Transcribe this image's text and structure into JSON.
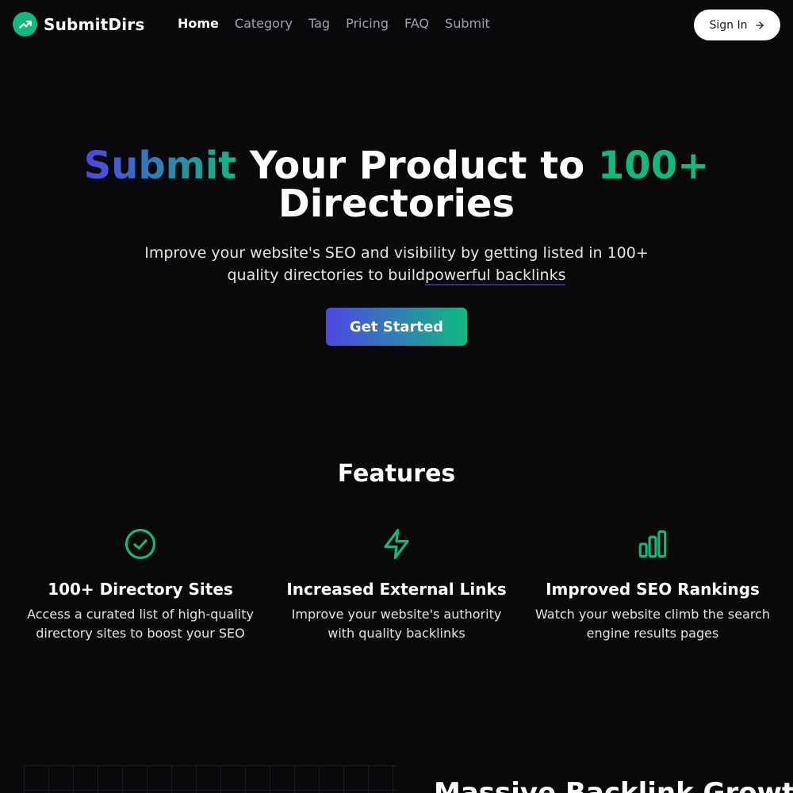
{
  "brand": {
    "name": "SubmitDirs",
    "logo_icon": "trending-up-icon",
    "accent": "#10b981",
    "accent_alt": "#4f46e5"
  },
  "nav": {
    "items": [
      {
        "label": "Home",
        "active": true
      },
      {
        "label": "Category"
      },
      {
        "label": "Tag"
      },
      {
        "label": "Pricing"
      },
      {
        "label": "FAQ"
      },
      {
        "label": "Submit"
      }
    ]
  },
  "header": {
    "signin_label": "Sign In",
    "signin_icon": "arrow-right-icon"
  },
  "hero": {
    "title_word1": "Submit",
    "title_mid": " Your Product to ",
    "title_num": "100+",
    "title_line2": "Directories",
    "subtitle_part1": "Improve your website's SEO and visibility by getting listed in 100+ quality directories to build",
    "subtitle_part2": "powerful backlinks",
    "cta_label": "Get Started"
  },
  "features": {
    "title": "Features",
    "items": [
      {
        "icon": "check-circle-icon",
        "title": "100+ Directory Sites",
        "desc": "Access a curated list of high-quality directory sites to boost your SEO"
      },
      {
        "icon": "lightning-bolt-icon",
        "title": "Increased External Links",
        "desc": "Improve your website's authority with quality backlinks"
      },
      {
        "icon": "bar-chart-icon",
        "title": "Improved SEO Rankings",
        "desc": "Watch your website climb the search engine results pages"
      }
    ]
  },
  "bottom": {
    "title": "Massive Backlink Growth"
  }
}
